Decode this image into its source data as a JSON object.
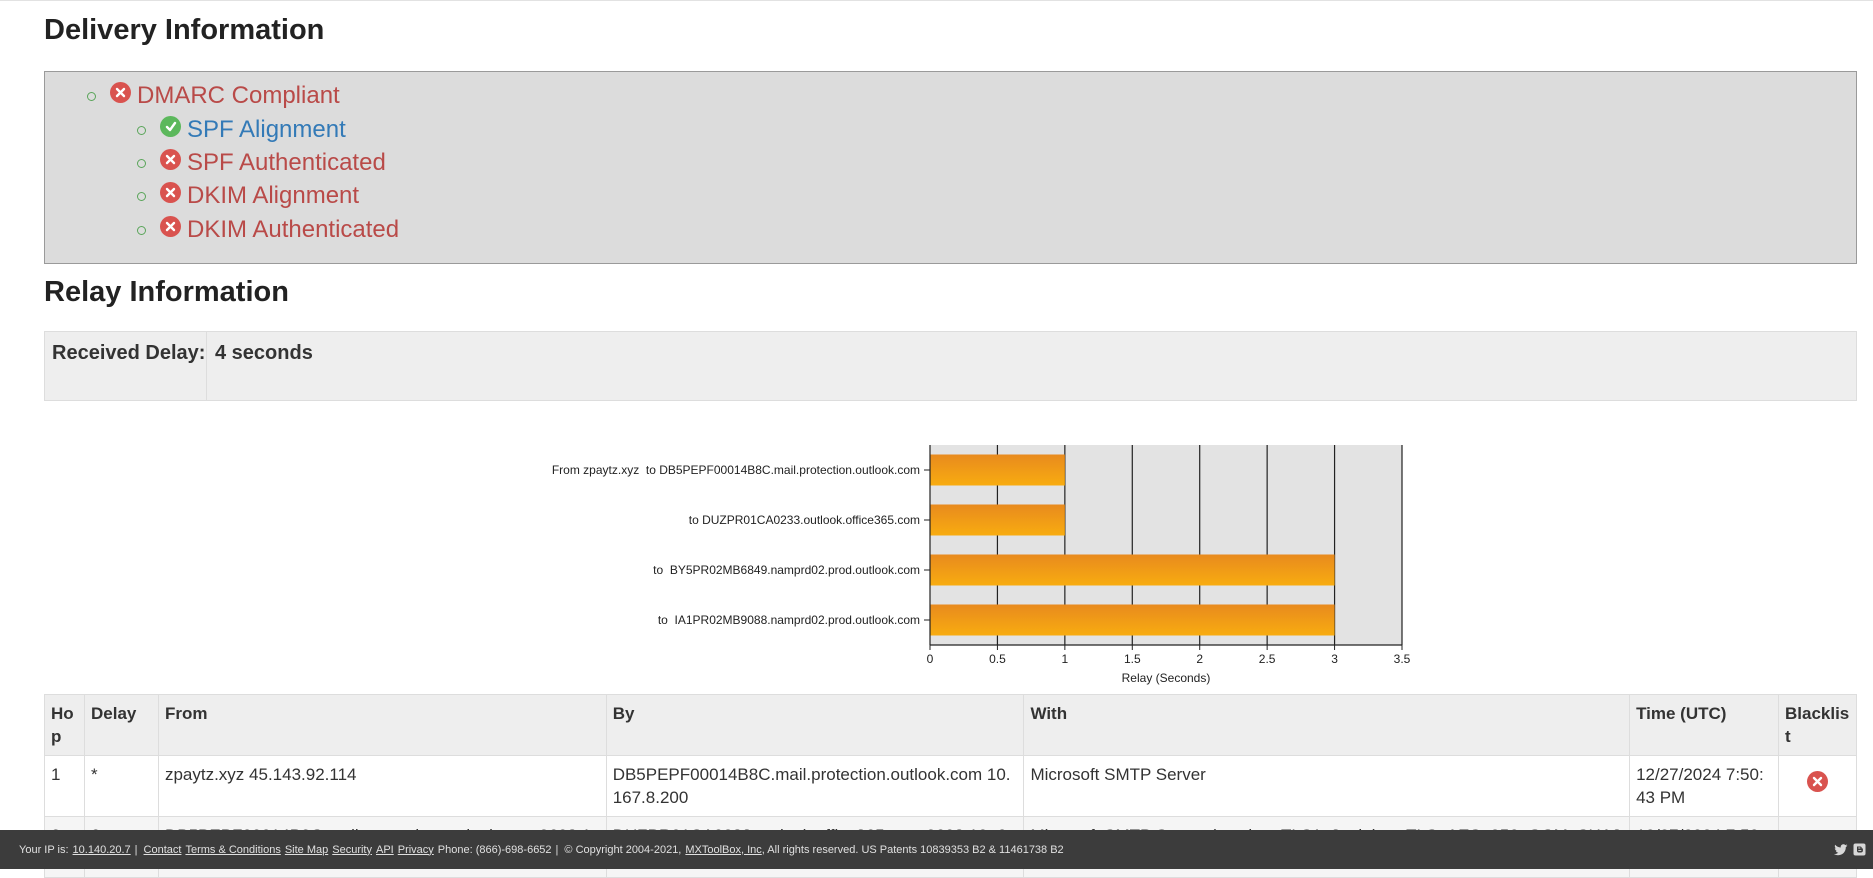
{
  "delivery": {
    "title": "Delivery Information",
    "items": [
      {
        "label": "DMARC Compliant",
        "status": "fail",
        "level": 1
      },
      {
        "label": "SPF Alignment",
        "status": "pass",
        "level": 2
      },
      {
        "label": "SPF Authenticated",
        "status": "fail",
        "level": 2
      },
      {
        "label": "DKIM Alignment",
        "status": "fail",
        "level": 2
      },
      {
        "label": "DKIM Authenticated",
        "status": "fail",
        "level": 2
      }
    ]
  },
  "relay": {
    "title": "Relay Information",
    "received_delay_label": "Received Delay:",
    "received_delay_value": "4 seconds"
  },
  "chart_data": {
    "type": "bar",
    "orientation": "horizontal",
    "categories": [
      "From zpaytz.xyz  to DB5PEPF00014B8C.mail.protection.outlook.com",
      "to DUZPR01CA0233.outlook.office365.com",
      "to  BY5PR02MB6849.namprd02.prod.outlook.com",
      "to  IA1PR02MB9088.namprd02.prod.outlook.com"
    ],
    "values": [
      1,
      1,
      3,
      3
    ],
    "xlabel": "Relay (Seconds)",
    "xlim": [
      0,
      3.5
    ],
    "xticks": [
      "0",
      "0.5",
      "1",
      "1.5",
      "2",
      "2.5",
      "3",
      "3.5"
    ],
    "grid": true,
    "bar_color": "#f0a020"
  },
  "hops": {
    "headers": [
      "Hop",
      "Delay",
      "From",
      "By",
      "With",
      "Time (UTC)",
      "Blacklist"
    ],
    "rows": [
      {
        "hop": "1",
        "delay": "*",
        "from": "zpaytz.xyz 45.143.92.114",
        "by": "DB5PEPF00014B8C.mail.protection.outlook.com 10.167.8.200",
        "with": "Microsoft SMTP Server",
        "time": "12/27/2024 7:50:43 PM",
        "blacklist": "fail"
      },
      {
        "hop": "2",
        "delay": "0",
        "from": "DB5PEPF00014B8C.mail.protection.outlook.com 2603:10",
        "by": "DUZPR01CA0233.outlook.office365.com 2603:10a6:10",
        "with": "Microsoft SMTP Server (version=TLS1_3, cipher=TLS_AES_256_GCM_SHA384)",
        "time": "12/27/2024 7:50:4",
        "blacklist": "pass"
      }
    ]
  },
  "footer": {
    "ip_prefix": "Your IP is:",
    "ip": "10.140.20.7",
    "links": [
      "Contact",
      "Terms & Conditions",
      "Site Map",
      "Security",
      "API",
      "Privacy"
    ],
    "phone": "Phone: (866)-698-6652",
    "copyright": "© Copyright 2004-2021,",
    "company": "MXToolBox, Inc",
    "rights": ", All rights reserved. US Patents 10839353 B2 & 11461738 B2"
  },
  "icons": {
    "fail": "circle-x-icon",
    "pass": "circle-check-icon",
    "twitter": "twitter-icon",
    "blogger": "blogger-icon"
  },
  "colors": {
    "fail": "#d9534f",
    "pass": "#5cb85c",
    "fail_text": "#b94a48",
    "pass_text": "#337ab7",
    "footer_bg": "#3c3c3c"
  }
}
